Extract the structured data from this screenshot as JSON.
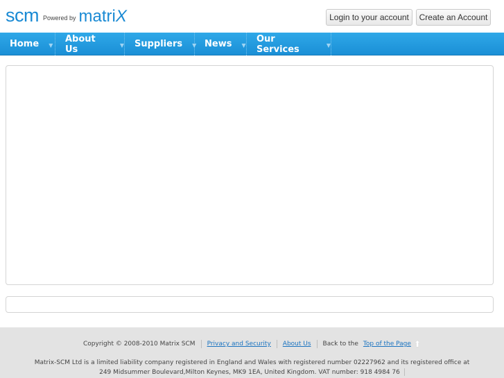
{
  "logo": {
    "brand": "scm",
    "powered_by": "Powered by",
    "partner": "matri",
    "partner_x": "X"
  },
  "header": {
    "login_label": "Login to your account",
    "create_label": "Create an Account"
  },
  "nav": {
    "items": [
      {
        "label": "Home"
      },
      {
        "label": "About Us"
      },
      {
        "label": "Suppliers"
      },
      {
        "label": "News"
      },
      {
        "label": "Our Services"
      }
    ]
  },
  "footer": {
    "copyright": "Copyright © 2008-2010 Matrix SCM",
    "privacy_link": "Privacy and Security",
    "about_link": "About Us",
    "back_to": "Back to the",
    "top_link": "Top of the Page",
    "legal_line1": "Matrix-SCM Ltd is a limited liability company registered in England and Wales with registered number 02227962 and its registered office at",
    "legal_line2": "249 Midsummer Boulevard,Milton Keynes, MK9 1EA, United Kingdom. VAT number: 918 4984 76"
  },
  "colors": {
    "brand_blue": "#1a8ad4",
    "nav_bg": "#1a8fd6",
    "footer_bg": "#e3e3e3"
  }
}
